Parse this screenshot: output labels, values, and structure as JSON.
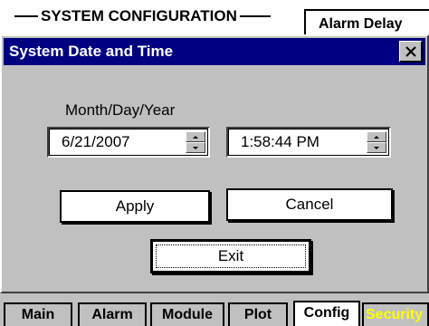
{
  "background": {
    "screen_title": "SYSTEM CONFIGURATION",
    "alarm_delay_label": "Alarm Delay"
  },
  "dialog": {
    "title": "System Date and Time",
    "close_icon": "close-icon",
    "date_label": "Month/Day/Year",
    "date_value": "6/21/2007",
    "time_value": "1:58:44 PM",
    "apply_label": "Apply",
    "cancel_label": "Cancel",
    "exit_label": "Exit"
  },
  "tabs": [
    {
      "label": "Main"
    },
    {
      "label": "Alarm"
    },
    {
      "label": "Module"
    },
    {
      "label": "Plot"
    },
    {
      "label": "Config",
      "active": true
    },
    {
      "label": "Security"
    }
  ],
  "colors": {
    "titlebar": "#000080",
    "face": "#c0c0c0",
    "security_text": "#ffff00"
  }
}
